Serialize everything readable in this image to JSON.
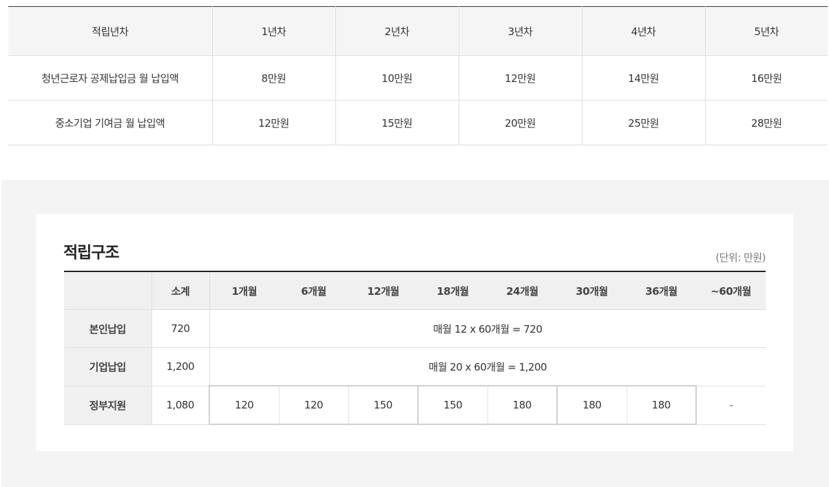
{
  "savings_table": {
    "header": [
      "적립년차",
      "1년차",
      "2년차",
      "3년차",
      "4년차",
      "5년차"
    ],
    "rows": [
      {
        "label": "청년근로자 공제납입금 월 납입액",
        "values": [
          "8만원",
          "10만원",
          "12만원",
          "14만원",
          "16만원"
        ]
      },
      {
        "label": "중소기업 기여금 월 납입액",
        "values": [
          "12만원",
          "15만원",
          "20만원",
          "25만원",
          "28만원"
        ]
      }
    ]
  },
  "structure": {
    "title": "적립구조",
    "unit": "(단위: 만원)",
    "header": [
      "",
      "소계",
      "1개월",
      "6개월",
      "12개월",
      "18개월",
      "24개월",
      "30개월",
      "36개월",
      "~60개월"
    ],
    "personal": {
      "label": "본인납입",
      "subtotal": "720",
      "formula": "매월 12 x 60개월 = 720"
    },
    "company": {
      "label": "기업납입",
      "subtotal": "1,200",
      "formula": "매월 20 x 60개월 = 1,200"
    },
    "government": {
      "label": "정부지원",
      "subtotal": "1,080",
      "values": [
        "120",
        "120",
        "150",
        "150",
        "180",
        "180",
        "180",
        "-"
      ]
    }
  }
}
